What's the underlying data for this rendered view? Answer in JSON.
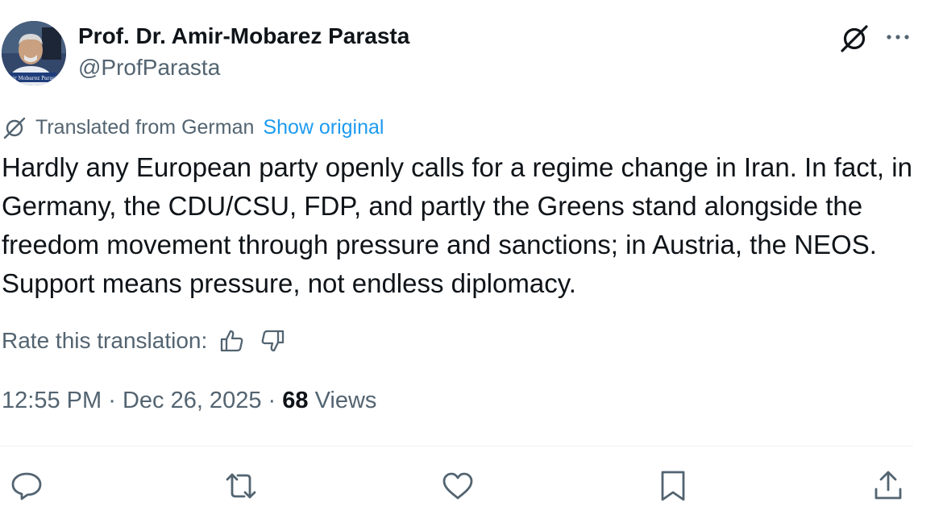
{
  "author": {
    "display_name": "Prof. Dr. Amir-Mobarez Parasta",
    "handle": "@ProfParasta",
    "avatar_caption": "Amir Mobarez Parasta"
  },
  "header_icons": {
    "grok": "grok-icon",
    "more": "more-icon"
  },
  "translation": {
    "notice": "Translated from German",
    "show_original": "Show original",
    "icon": "grok-icon"
  },
  "tweet": {
    "text": "Hardly any European party openly calls for a regime change in Iran. In fact, in Germany, the CDU/CSU, FDP, and partly the Greens stand alongside the freedom movement through pressure and sanctions; in Austria, the NEOS. Support means pressure, not endless diplomacy."
  },
  "rating": {
    "label": "Rate this translation:",
    "up_icon": "thumbs-up-icon",
    "down_icon": "thumbs-down-icon"
  },
  "meta": {
    "time": "12:55 PM",
    "separator": "·",
    "date": "Dec 26, 2025",
    "views_count": "68",
    "views_label": "Views"
  },
  "actions": [
    "reply-icon",
    "retweet-icon",
    "like-icon",
    "bookmark-icon",
    "share-icon"
  ],
  "colors": {
    "text": "#0f1419",
    "secondary": "#536471",
    "link": "#1d9bf0",
    "divider": "#eff3f4"
  }
}
